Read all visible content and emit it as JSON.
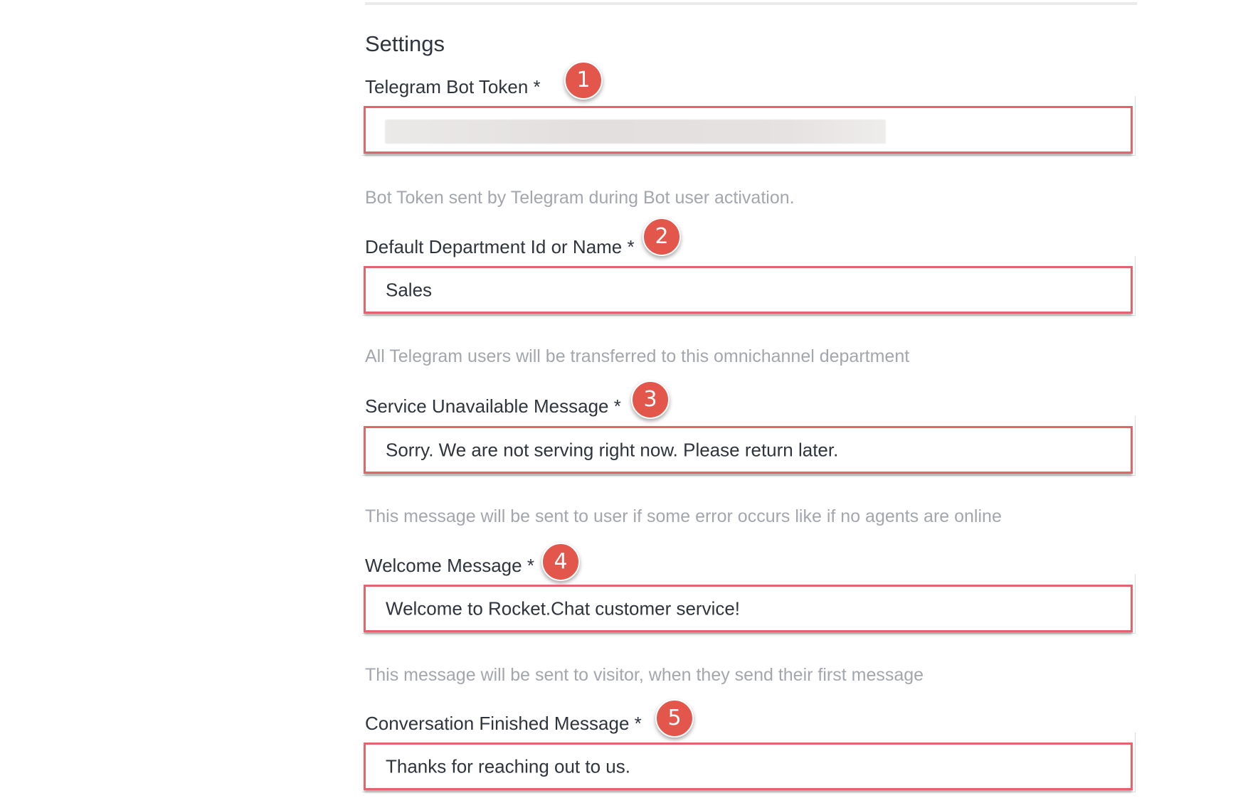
{
  "section": {
    "title": "Settings"
  },
  "fields": [
    {
      "label": "Telegram Bot Token *",
      "value": "",
      "hint": "Bot Token sent by Telegram during Bot user activation.",
      "badge": "1"
    },
    {
      "label": "Default Department Id or Name *",
      "value": "Sales",
      "hint": "All Telegram users will be transferred to this omnichannel department",
      "badge": "2"
    },
    {
      "label": "Service Unavailable Message *",
      "value": "Sorry. We are not serving right now. Please return later.",
      "hint": "This message will be sent to user if some error occurs like if no agents are online",
      "badge": "3"
    },
    {
      "label": "Welcome Message *",
      "value": "Welcome to Rocket.Chat customer service!",
      "hint": "This message will be sent to visitor, when they send their first message",
      "badge": "4"
    },
    {
      "label": "Conversation Finished Message *",
      "value": "Thanks for reaching out to us.",
      "badge": "5"
    }
  ],
  "colors": {
    "highlight_border": "#e2656b",
    "badge_fill": "#e2564c",
    "hint_text": "#a3a7ad",
    "label_text": "#2f343d"
  }
}
